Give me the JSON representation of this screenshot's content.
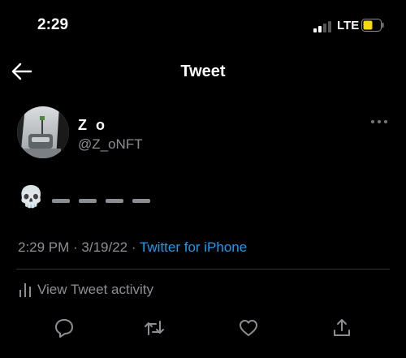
{
  "status_bar": {
    "time": "2:29",
    "network": "LTE",
    "icons": [
      "signal-icon",
      "battery-icon"
    ],
    "battery_color": "#f5d90a"
  },
  "header": {
    "title": "Tweet",
    "back_icon": "back-arrow-icon"
  },
  "author": {
    "name": "Z o",
    "handle": "@Z_oNFT"
  },
  "tweet": {
    "emoji": "💀",
    "dash_count": 4,
    "timestamp": "2:29 PM · 3/19/22 · ",
    "source": "Twitter for iPhone"
  },
  "activity": {
    "label": "View Tweet activity"
  },
  "actions": {
    "icons": [
      "reply-icon",
      "retweet-icon",
      "like-icon",
      "share-icon"
    ]
  },
  "colors": {
    "background": "#000000",
    "link": "#1d9bf0",
    "muted": "#8b8f94"
  }
}
